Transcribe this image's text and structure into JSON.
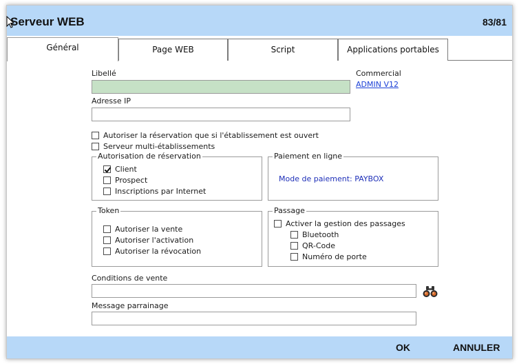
{
  "window": {
    "title": "Serveur WEB",
    "counter": "83/81"
  },
  "tabs": [
    {
      "label": "Général"
    },
    {
      "label": "Page WEB"
    },
    {
      "label": "Script"
    },
    {
      "label": "Applications portables"
    }
  ],
  "form": {
    "libelle_label": "Libellé",
    "libelle_value": "",
    "commercial_label": "Commercial",
    "commercial_value": "ADMIN V12",
    "adresse_ip_label": "Adresse IP",
    "adresse_ip_value": "",
    "check_etablissement_ouvert": {
      "label": "Autoriser la réservation que si l'établissement est ouvert",
      "checked": false
    },
    "check_multi_etablissements": {
      "label": "Serveur multi-établissements",
      "checked": false
    }
  },
  "groups": {
    "autorisation": {
      "title": "Autorisation de réservation",
      "items": [
        {
          "label": "Client",
          "checked": true
        },
        {
          "label": "Prospect",
          "checked": false
        },
        {
          "label": "Inscriptions par Internet",
          "checked": false
        }
      ]
    },
    "paiement": {
      "title": "Paiement en ligne",
      "mode": "Mode de paiement: PAYBOX"
    },
    "token": {
      "title": "Token",
      "items": [
        {
          "label": "Autoriser la vente",
          "checked": false
        },
        {
          "label": "Autoriser l'activation",
          "checked": false
        },
        {
          "label": "Autoriser la révocation",
          "checked": false
        }
      ]
    },
    "passage": {
      "title": "Passage",
      "main": {
        "label": "Activer la gestion des passages",
        "checked": false
      },
      "items": [
        {
          "label": "Bluetooth",
          "checked": false
        },
        {
          "label": "QR-Code",
          "checked": false
        },
        {
          "label": "Numéro de porte",
          "checked": false
        }
      ]
    }
  },
  "conditions": {
    "label": "Conditions de vente",
    "value": ""
  },
  "parrainage": {
    "label": "Message parrainage",
    "value": ""
  },
  "footer": {
    "ok_label": "OK",
    "cancel_label": "ANNULER"
  },
  "colors": {
    "header_bg": "#b7d8f8",
    "libelle_bg": "#c6e1c6",
    "link": "#1a3fd6",
    "payment_text": "#1e2fb8"
  }
}
